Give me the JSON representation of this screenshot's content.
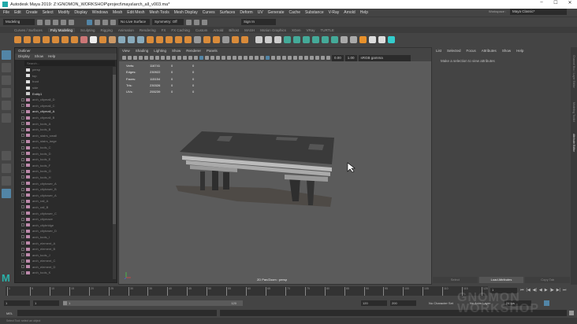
{
  "window": {
    "title": "Autodesk Maya 2019: Z:\\GNOMON_WORKSHOP\\project\\maya\\arch_all_v003.ma*",
    "minimize": "–",
    "maximize": "☐",
    "close": "✕"
  },
  "menubar": [
    "File",
    "Edit",
    "Create",
    "Select",
    "Modify",
    "Display",
    "Windows",
    "Mesh",
    "Edit Mesh",
    "Mesh Tools",
    "Mesh Display",
    "Curves",
    "Surfaces",
    "Deform",
    "UV",
    "Generate",
    "Cache",
    "Substance",
    "V-Ray",
    "Arnold",
    "Help"
  ],
  "status": {
    "mode": "Modeling",
    "live_surface": "No Live Surface",
    "symmetry": "Symmetry: Off",
    "sign_in": "Sign In",
    "workspace_label": "Workspace :",
    "workspace": "Maya Classic*"
  },
  "shelf_tabs": [
    "Curves / Surfaces",
    "Poly Modeling",
    "Sculpting",
    "Rigging",
    "Animation",
    "Rendering",
    "FX",
    "FX Caching",
    "Custom",
    "Arnold",
    "Bifrost",
    "MASH",
    "Motion Graphics",
    "XGen",
    "VRay",
    "TURTLE"
  ],
  "shelf_active": "Poly Modeling",
  "outliner": {
    "title": "Outliner",
    "menu": [
      "Display",
      "Show",
      "Help"
    ],
    "search_placeholder": "Search...",
    "cameras": [
      "persp",
      "top",
      "front",
      "side"
    ],
    "locator": "Entity1",
    "items": [
      "arch_citymall_D",
      "arch_citymall_C",
      "arch_citymall_A",
      "arch_citymall_B",
      "arch_tools_A",
      "arch_tools_B",
      "arch_stairs_small",
      "arch_stairs_large",
      "arch_tools_C",
      "arch_tools_D",
      "arch_tools_E",
      "arch_tools_F",
      "arch_tools_G",
      "arch_tools_H",
      "arch_citytower_A",
      "arch_citytower_B",
      "arch_citytower_A",
      "arch_rail_A",
      "arch_rail_B",
      "arch_citytower_C",
      "arch_citymaze",
      "arch_citybridge",
      "arch_citytower_D",
      "arch_tools_I",
      "arch_element_A",
      "arch_element_B",
      "arch_tools_J",
      "arch_element_C",
      "arch_element_D",
      "arch_tools_K"
    ],
    "selected": "arch_citymall_A"
  },
  "viewport": {
    "menu": [
      "View",
      "Shading",
      "Lighting",
      "Show",
      "Renderer",
      "Panels"
    ],
    "exposure": "0.00",
    "gamma": "1.00",
    "color_space": "sRGB gamma",
    "hud": [
      [
        "Verts:",
        "116741",
        "0",
        "0"
      ],
      [
        "Edges:",
        "230922",
        "0",
        "0"
      ],
      [
        "Faces:",
        "115154",
        "0",
        "0"
      ],
      [
        "Tris:",
        "230326",
        "0",
        "0"
      ],
      [
        "UVs:",
        "255239",
        "0",
        "0"
      ]
    ],
    "camera_label": "2D Pan/Zoom : persp"
  },
  "attribute_editor": {
    "menu": [
      "List",
      "Selected",
      "Focus",
      "Attributes",
      "Show",
      "Help"
    ],
    "message": "Make a selection to view attributes",
    "buttons": [
      "Select",
      "Load Attributes",
      "Copy Tab"
    ],
    "active_button": "Load Attributes"
  },
  "side_tabs": [
    "Channel Box / Layer Editor",
    "Modeling Toolkit",
    "Attribute Editor"
  ],
  "timeline": {
    "ticks": [
      "1",
      "5",
      "10",
      "15",
      "20",
      "25",
      "30",
      "35",
      "40",
      "45",
      "50",
      "55",
      "60",
      "65",
      "70",
      "75",
      "80",
      "85",
      "90",
      "95",
      "100",
      "105",
      "110",
      "115",
      "120"
    ],
    "current_frame": "1",
    "playback": [
      "⏮",
      "|◀",
      "◀|",
      "◀",
      "▶",
      "|▶",
      "▶|",
      "⏭"
    ]
  },
  "range": {
    "start": "1",
    "playback_start": "1",
    "range_start_label": "1",
    "range_end_label": "120",
    "playback_end": "120",
    "end": "200",
    "character_set": "No Character Set",
    "anim_layer": "No Anim Layer",
    "fps": "24 fps"
  },
  "mel": {
    "label": "MEL"
  },
  "help_line": "Select Tool: select an object",
  "watermark": "THE GNOMON WORKSHOP",
  "colors": {
    "accent": "#5285a6",
    "maya_logo": "#2ab0a8"
  }
}
